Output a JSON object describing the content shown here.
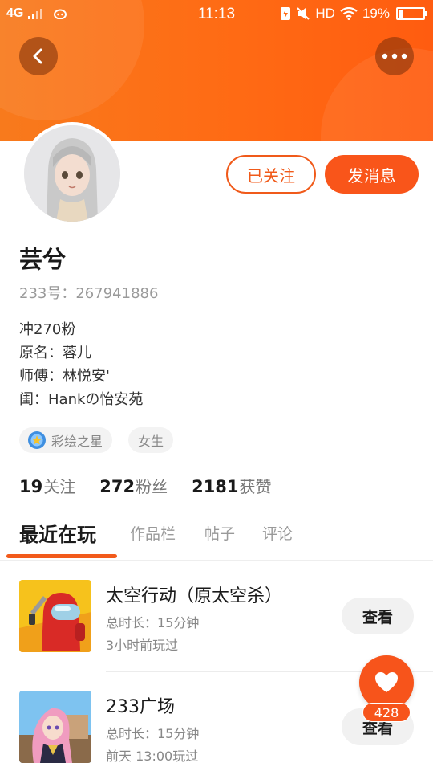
{
  "statusbar": {
    "network": "4G",
    "time": "11:13",
    "hd": "HD",
    "battery": "19%",
    "battery_level": 0.19
  },
  "profile": {
    "name": "芸兮",
    "uid": "233号：267941886",
    "bio": [
      "冲270粉",
      "原名：蓉儿",
      "师傅：林悦安'",
      "闺：Hankの怡安苑"
    ],
    "tags": [
      "彩绘之星",
      "女生"
    ]
  },
  "actions": {
    "follow": "已关注",
    "message": "发消息"
  },
  "stats": [
    {
      "value": "19",
      "label": "关注"
    },
    {
      "value": "272",
      "label": "粉丝"
    },
    {
      "value": "2181",
      "label": "获赞"
    }
  ],
  "tabs": [
    "最近在玩",
    "作品栏",
    "帖子",
    "评论"
  ],
  "games": [
    {
      "title": "太空行动（原太空杀）",
      "duration": "总时长：15分钟",
      "last_played": "3小时前玩过",
      "button": "查看"
    },
    {
      "title": "233广场",
      "duration": "总时长：15分钟",
      "last_played": "前天 13:00玩过",
      "button": "查看"
    }
  ],
  "like": {
    "count": "428"
  },
  "colors": {
    "brand": "#f7541b",
    "header": "#ff6a14"
  },
  "icons": [
    "back-arrow-icon",
    "more-dots-icon",
    "heart-icon",
    "star-badge-icon",
    "wifi-icon"
  ]
}
